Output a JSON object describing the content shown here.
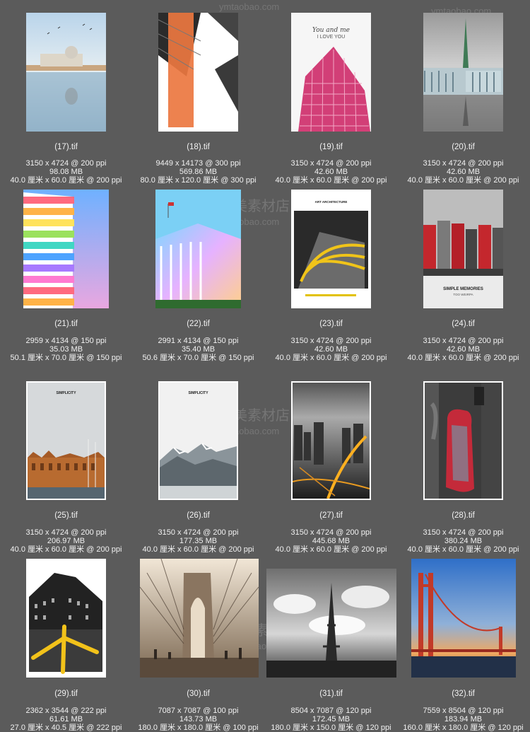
{
  "watermark": {
    "brand": "艺美素材店",
    "url": "ymtaobao.com"
  },
  "items": [
    {
      "name": "(17).tif",
      "dims": "3150 x 4724 @ 200 ppi",
      "size": "98.08 MB",
      "physical": "40.0 厘米 x 60.0 厘米 @ 200 ppi"
    },
    {
      "name": "(18).tif",
      "dims": "9449 x 14173 @ 300 ppi",
      "size": "569.86 MB",
      "physical": "80.0 厘米 x 120.0 厘米 @ 300 ppi"
    },
    {
      "name": "(19).tif",
      "dims": "3150 x 4724 @ 200 ppi",
      "size": "42.60 MB",
      "physical": "40.0 厘米 x 60.0 厘米 @ 200 ppi"
    },
    {
      "name": "(20).tif",
      "dims": "3150 x 4724 @ 200 ppi",
      "size": "42.60 MB",
      "physical": "40.0 厘米 x 60.0 厘米 @ 200 ppi"
    },
    {
      "name": "(21).tif",
      "dims": "2959 x 4134 @ 150 ppi",
      "size": "35.03 MB",
      "physical": "50.1 厘米 x 70.0 厘米 @ 150 ppi"
    },
    {
      "name": "(22).tif",
      "dims": "2991 x 4134 @ 150 ppi",
      "size": "35.40 MB",
      "physical": "50.6 厘米 x 70.0 厘米 @ 150 ppi"
    },
    {
      "name": "(23).tif",
      "dims": "3150 x 4724 @ 200 ppi",
      "size": "42.60 MB",
      "physical": "40.0 厘米 x 60.0 厘米 @ 200 ppi"
    },
    {
      "name": "(24).tif",
      "dims": "3150 x 4724 @ 200 ppi",
      "size": "42.60 MB",
      "physical": "40.0 厘米 x 60.0 厘米 @ 200 ppi"
    },
    {
      "name": "(25).tif",
      "dims": "3150 x 4724 @ 200 ppi",
      "size": "206.97 MB",
      "physical": "40.0 厘米 x 60.0 厘米 @ 200 ppi"
    },
    {
      "name": "(26).tif",
      "dims": "3150 x 4724 @ 200 ppi",
      "size": "177.35 MB",
      "physical": "40.0 厘米 x 60.0 厘米 @ 200 ppi"
    },
    {
      "name": "(27).tif",
      "dims": "3150 x 4724 @ 200 ppi",
      "size": "445.68 MB",
      "physical": "40.0 厘米 x 60.0 厘米 @ 200 ppi"
    },
    {
      "name": "(28).tif",
      "dims": "3150 x 4724 @ 200 ppi",
      "size": "380.24 MB",
      "physical": "40.0 厘米 x 60.0 厘米 @ 200 ppi"
    },
    {
      "name": "(29).tif",
      "dims": "2362 x 3544 @ 222 ppi",
      "size": "61.61 MB",
      "physical": "27.0 厘米 x 40.5 厘米 @ 222 ppi"
    },
    {
      "name": "(30).tif",
      "dims": "7087 x 7087 @ 100 ppi",
      "size": "143.73 MB",
      "physical": "180.0 厘米 x 180.0 厘米 @ 100 ppi"
    },
    {
      "name": "(31).tif",
      "dims": "8504 x 7087 @ 120 ppi",
      "size": "172.45 MB",
      "physical": "180.0 厘米 x 150.0 厘米 @ 120 ppi"
    },
    {
      "name": "(32).tif",
      "dims": "7559 x 8504 @ 120 ppi",
      "size": "183.94 MB",
      "physical": "160.0 厘米 x 180.0 厘米 @ 120 ppi"
    }
  ],
  "poster_text": {
    "p19_line1": "You and me",
    "p19_line2": "I LOVE YOU",
    "p23_title": "ART ARCHITECTURE",
    "p24_title": "SIMPLE MEMORIES",
    "p24_sub": "TOO WEIRPA",
    "p25_title": "SIMPLICITY",
    "p26_title": "SIMPLICITY"
  }
}
